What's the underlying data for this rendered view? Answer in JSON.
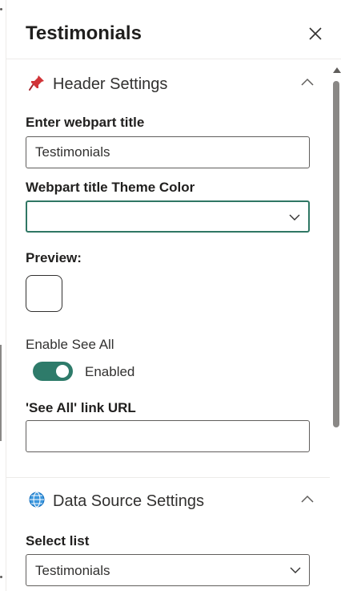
{
  "panel": {
    "title": "Testimonials",
    "close_icon": "close-icon"
  },
  "header_settings": {
    "icon": "pushpin-icon",
    "title": "Header Settings",
    "webpart_title_label": "Enter webpart title",
    "webpart_title_value": "Testimonials",
    "theme_color_label": "Webpart title Theme Color",
    "theme_color_value": "",
    "preview_label": "Preview:",
    "enable_see_all_label": "Enable See All",
    "enable_see_all_state": "Enabled",
    "see_all_url_label": "'See All' link URL",
    "see_all_url_value": ""
  },
  "data_source_settings": {
    "icon": "globe-icon",
    "title": "Data Source Settings",
    "select_list_label": "Select list",
    "select_list_value": "Testimonials"
  },
  "colors": {
    "accent": "#2e7b6a",
    "focus_border": "#2f7764",
    "pin": "#d13438",
    "globe": "#0f6cbd"
  }
}
